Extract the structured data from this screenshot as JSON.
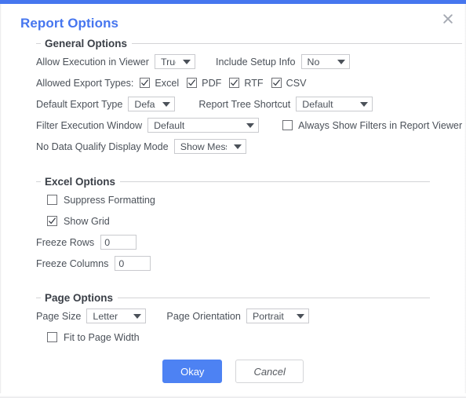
{
  "dialog": {
    "title": "Report Options",
    "close_icon": "close-icon",
    "accent_color": "#4676ef",
    "primary_button_color": "#4d82f3"
  },
  "sections": {
    "general": {
      "legend": "General Options",
      "allow_execution_label": "Allow Execution in Viewer",
      "allow_execution_value": "True",
      "include_setup_label": "Include Setup Info",
      "include_setup_value": "No",
      "allowed_export_label": "Allowed Export Types:",
      "export_types": [
        {
          "label": "Excel",
          "checked": true
        },
        {
          "label": "PDF",
          "checked": true
        },
        {
          "label": "RTF",
          "checked": true
        },
        {
          "label": "CSV",
          "checked": true
        }
      ],
      "default_export_label": "Default Export Type",
      "default_export_value": "Default",
      "report_tree_label": "Report Tree Shortcut",
      "report_tree_value": "Default",
      "filter_window_label": "Filter Execution Window",
      "filter_window_value": "Default",
      "always_show_filters_label": "Always Show Filters in Report Viewer",
      "always_show_filters_checked": false,
      "no_data_label": "No Data Qualify Display Mode",
      "no_data_value": "Show Message"
    },
    "excel": {
      "legend": "Excel Options",
      "suppress_formatting_label": "Suppress Formatting",
      "suppress_formatting_checked": false,
      "show_grid_label": "Show Grid",
      "show_grid_checked": true,
      "freeze_rows_label": "Freeze Rows",
      "freeze_rows_value": "0",
      "freeze_columns_label": "Freeze Columns",
      "freeze_columns_value": "0"
    },
    "page": {
      "legend": "Page Options",
      "page_size_label": "Page Size",
      "page_size_value": "Letter",
      "page_orientation_label": "Page Orientation",
      "page_orientation_value": "Portrait",
      "fit_to_width_label": "Fit to Page Width",
      "fit_to_width_checked": false
    }
  },
  "footer": {
    "okay_label": "Okay",
    "cancel_label": "Cancel"
  }
}
